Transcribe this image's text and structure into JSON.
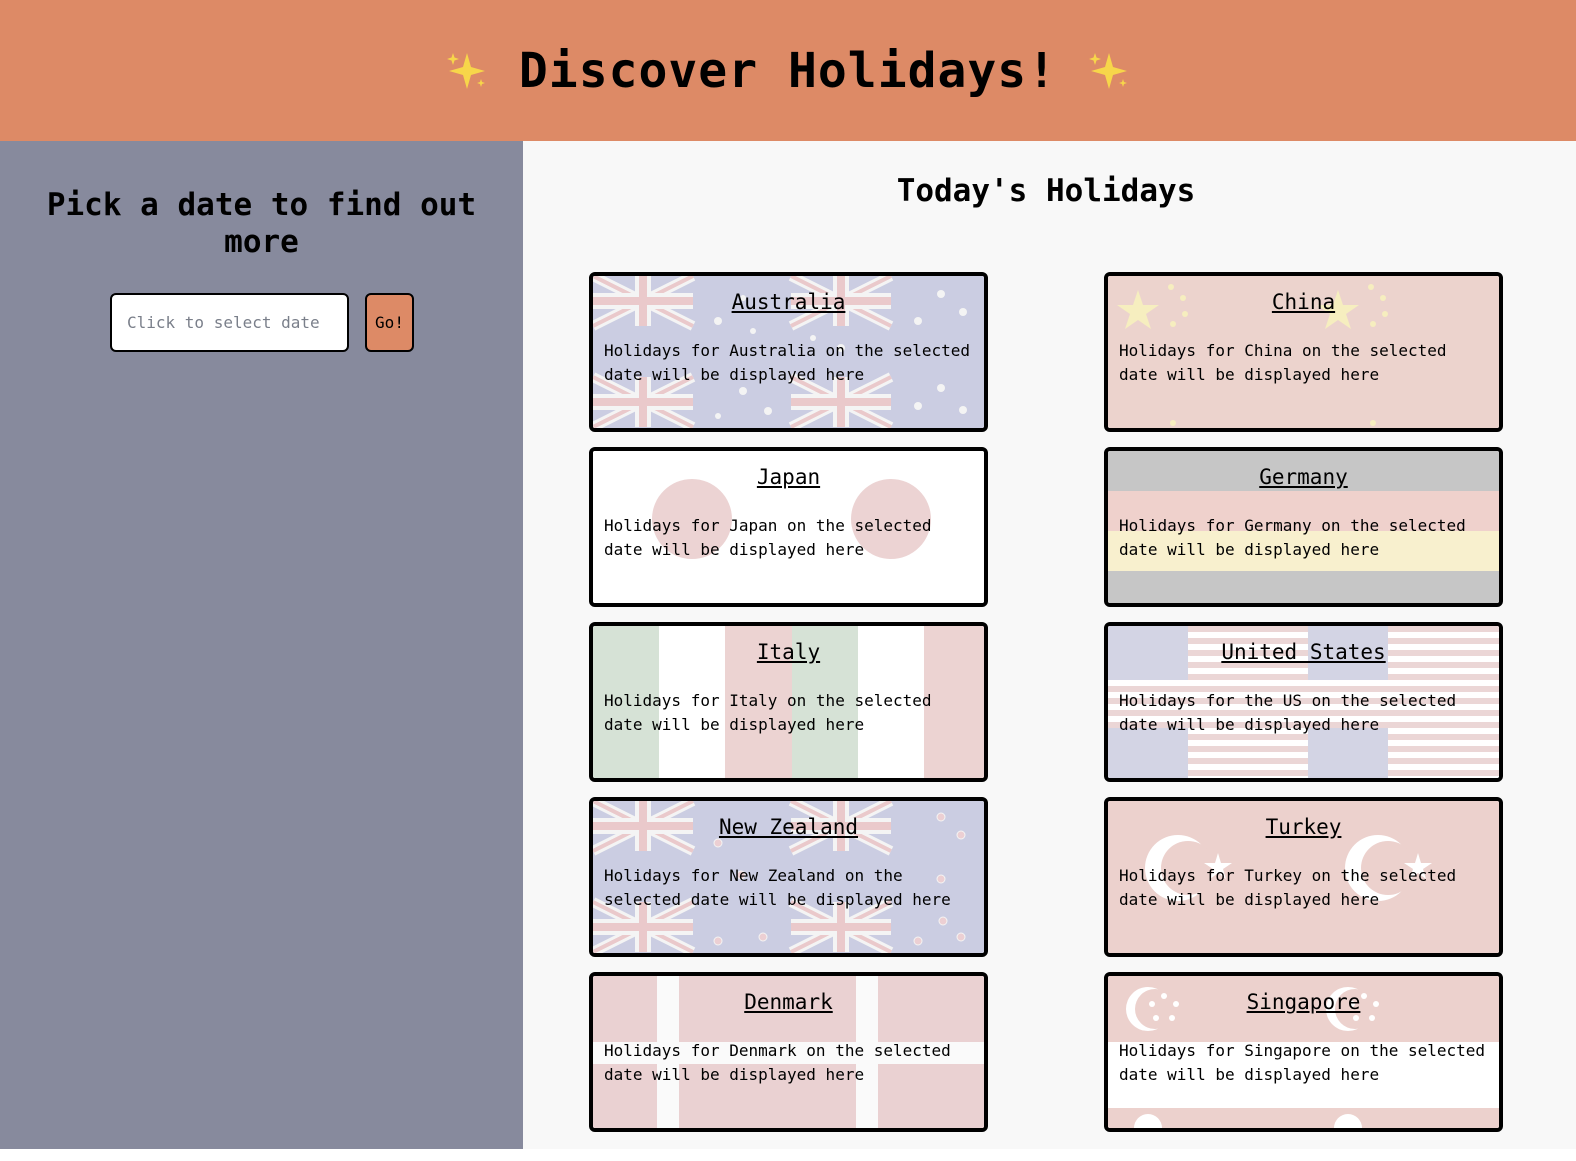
{
  "header": {
    "title": "Discover Holidays!",
    "sparkle_icon": "sparkles-icon"
  },
  "sidebar": {
    "heading": "Pick a date to find out more",
    "date_placeholder": "Click to select date",
    "go_label": "Go!"
  },
  "main": {
    "heading": "Today's Holidays",
    "cards": [
      {
        "country": "Australia",
        "text": "Holidays for Australia on the selected date will be displayed here"
      },
      {
        "country": "China",
        "text": "Holidays for China on the selected date will be displayed here"
      },
      {
        "country": "Japan",
        "text": "Holidays for Japan on the selected date will be displayed here"
      },
      {
        "country": "Germany",
        "text": "Holidays for Germany on the selected date will be displayed here"
      },
      {
        "country": "Italy",
        "text": "Holidays for Italy on the selected date will be displayed here"
      },
      {
        "country": "United States",
        "text": "Holidays for the US on the selected date will be displayed here"
      },
      {
        "country": "New Zealand",
        "text": "Holidays for New Zealand on the selected date will be displayed here"
      },
      {
        "country": "Turkey",
        "text": "Holidays for Turkey on the selected date will be displayed here"
      },
      {
        "country": "Denmark",
        "text": "Holidays for Denmark on the selected date will be displayed here"
      },
      {
        "country": "Singapore",
        "text": "Holidays for Singapore on the selected date will be displayed here"
      }
    ]
  },
  "colors": {
    "header_bg": "#dd8a66",
    "sidebar_bg": "#878a9d",
    "main_bg": "#f8f8f8",
    "button_bg": "#dd8a66"
  }
}
